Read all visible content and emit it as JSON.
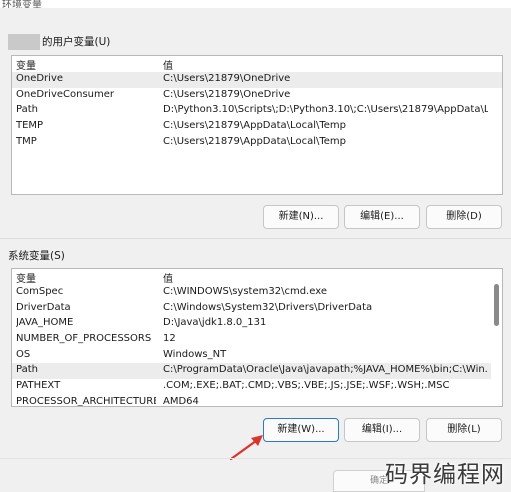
{
  "window": {
    "title": "环境变量"
  },
  "user_section": {
    "label": "的用户变量(U)",
    "columns": [
      "变量",
      "值"
    ],
    "rows": [
      {
        "name": "OneDrive",
        "value": "C:\\Users\\21879\\OneDrive"
      },
      {
        "name": "OneDriveConsumer",
        "value": "C:\\Users\\21879\\OneDrive"
      },
      {
        "name": "Path",
        "value": "D:\\Python3.10\\Scripts\\;D:\\Python3.10\\;C:\\Users\\21879\\AppData\\L..."
      },
      {
        "name": "TEMP",
        "value": "C:\\Users\\21879\\AppData\\Local\\Temp"
      },
      {
        "name": "TMP",
        "value": "C:\\Users\\21879\\AppData\\Local\\Temp"
      }
    ],
    "buttons": {
      "new": "新建(N)...",
      "edit": "编辑(E)...",
      "delete": "删除(D)"
    }
  },
  "system_section": {
    "label": "系统变量(S)",
    "columns": [
      "变量",
      "值"
    ],
    "rows": [
      {
        "name": "ComSpec",
        "value": "C:\\WINDOWS\\system32\\cmd.exe"
      },
      {
        "name": "DriverData",
        "value": "C:\\Windows\\System32\\Drivers\\DriverData"
      },
      {
        "name": "JAVA_HOME",
        "value": "D:\\Java\\jdk1.8.0_131"
      },
      {
        "name": "NUMBER_OF_PROCESSORS",
        "value": "12"
      },
      {
        "name": "OS",
        "value": "Windows_NT"
      },
      {
        "name": "Path",
        "value": "C:\\ProgramData\\Oracle\\Java\\javapath;%JAVA_HOME%\\bin;C:\\Win..."
      },
      {
        "name": "PATHEXT",
        "value": ".COM;.EXE;.BAT;.CMD;.VBS;.VBE;.JS;.JSE;.WSF;.WSH;.MSC"
      },
      {
        "name": "PROCESSOR_ARCHITECTURE",
        "value": "AMD64"
      }
    ],
    "buttons": {
      "new": "新建(W)...",
      "edit": "编辑(I)...",
      "delete": "删除(L)"
    }
  },
  "footer": {
    "ok": "确定"
  },
  "watermark": "码界编程网",
  "colors": {
    "focus_border": "#2b79c8",
    "annotation_arrow": "#d9352c"
  }
}
